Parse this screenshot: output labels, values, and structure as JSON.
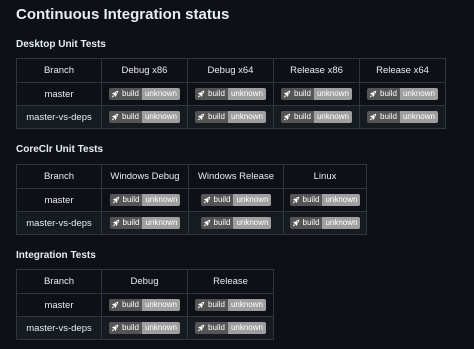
{
  "page_title": "Continuous Integration status",
  "badge": {
    "label": "build",
    "status": "unknown",
    "icon": "rocket-icon"
  },
  "sections": [
    {
      "heading": "Desktop Unit Tests",
      "columns": [
        "Branch",
        "Debug x86",
        "Debug x64",
        "Release x86",
        "Release x64"
      ],
      "rows": [
        "master",
        "master-vs-deps"
      ]
    },
    {
      "heading": "CoreClr Unit Tests",
      "columns": [
        "Branch",
        "Windows Debug",
        "Windows Release",
        "Linux"
      ],
      "rows": [
        "master",
        "master-vs-deps"
      ]
    },
    {
      "heading": "Integration Tests",
      "columns": [
        "Branch",
        "Debug",
        "Release"
      ],
      "rows": [
        "master",
        "master-vs-deps"
      ]
    }
  ]
}
